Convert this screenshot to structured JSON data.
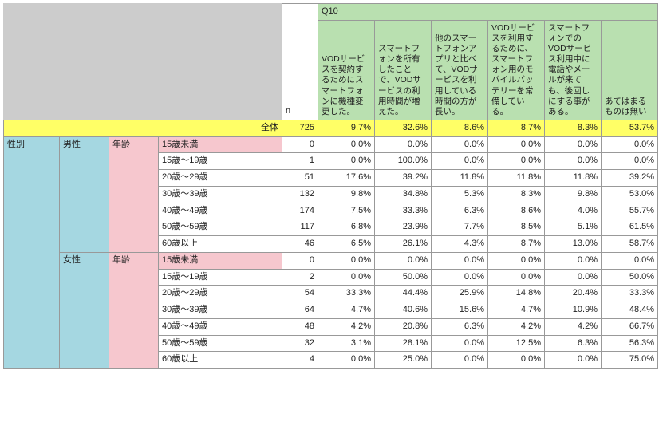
{
  "question": "Q10",
  "n_label": "n",
  "columns": [
    "VODサービスを契約するためにスマートフォンに機種変更した。",
    "スマートフォンを所有したことで、VODサービスの利用時間が増えた。",
    "他のスマートフォンアプリと比べて、VODサービスを利用している時間の方が長い。",
    "VODサービスを利用するために、スマートフォン用のモバイルバッテリーを常備している。",
    "スマートフォンでのVODサービス利用中に電話やメールが来ても、後回しにする事がある。",
    "あてはまるものは無い"
  ],
  "total_label": "全体",
  "total": {
    "n": "725",
    "v": [
      "9.7%",
      "32.6%",
      "8.6%",
      "8.7%",
      "8.3%",
      "53.7%"
    ]
  },
  "dim1": "性別",
  "dim2": "年齢",
  "genders": [
    "男性",
    "女性"
  ],
  "ages": [
    "15歳未満",
    "15歳～19歳",
    "20歳～29歳",
    "30歳～39歳",
    "40歳～49歳",
    "50歳～59歳",
    "60歳以上"
  ],
  "rows": {
    "male": [
      {
        "n": "0",
        "v": [
          "0.0%",
          "0.0%",
          "0.0%",
          "0.0%",
          "0.0%",
          "0.0%"
        ]
      },
      {
        "n": "1",
        "v": [
          "0.0%",
          "100.0%",
          "0.0%",
          "0.0%",
          "0.0%",
          "0.0%"
        ]
      },
      {
        "n": "51",
        "v": [
          "17.6%",
          "39.2%",
          "11.8%",
          "11.8%",
          "11.8%",
          "39.2%"
        ]
      },
      {
        "n": "132",
        "v": [
          "9.8%",
          "34.8%",
          "5.3%",
          "8.3%",
          "9.8%",
          "53.0%"
        ]
      },
      {
        "n": "174",
        "v": [
          "7.5%",
          "33.3%",
          "6.3%",
          "8.6%",
          "4.0%",
          "55.7%"
        ]
      },
      {
        "n": "117",
        "v": [
          "6.8%",
          "23.9%",
          "7.7%",
          "8.5%",
          "5.1%",
          "61.5%"
        ]
      },
      {
        "n": "46",
        "v": [
          "6.5%",
          "26.1%",
          "4.3%",
          "8.7%",
          "13.0%",
          "58.7%"
        ]
      }
    ],
    "female": [
      {
        "n": "0",
        "v": [
          "0.0%",
          "0.0%",
          "0.0%",
          "0.0%",
          "0.0%",
          "0.0%"
        ]
      },
      {
        "n": "2",
        "v": [
          "0.0%",
          "50.0%",
          "0.0%",
          "0.0%",
          "0.0%",
          "50.0%"
        ]
      },
      {
        "n": "54",
        "v": [
          "33.3%",
          "44.4%",
          "25.9%",
          "14.8%",
          "20.4%",
          "33.3%"
        ]
      },
      {
        "n": "64",
        "v": [
          "4.7%",
          "40.6%",
          "15.6%",
          "4.7%",
          "10.9%",
          "48.4%"
        ]
      },
      {
        "n": "48",
        "v": [
          "4.2%",
          "20.8%",
          "6.3%",
          "4.2%",
          "4.2%",
          "66.7%"
        ]
      },
      {
        "n": "32",
        "v": [
          "3.1%",
          "28.1%",
          "0.0%",
          "12.5%",
          "6.3%",
          "56.3%"
        ]
      },
      {
        "n": "4",
        "v": [
          "0.0%",
          "25.0%",
          "0.0%",
          "0.0%",
          "0.0%",
          "75.0%"
        ]
      }
    ]
  },
  "chart_data": {
    "type": "table",
    "title": "Q10",
    "row_dim": [
      "性別",
      "年齢"
    ],
    "columns_n": "n",
    "columns": [
      "VODサービスを契約するためにスマートフォンに機種変更した。",
      "スマートフォンを所有したことで、VODサービスの利用時間が増えた。",
      "他のスマートフォンアプリと比べて、VODサービスを利用している時間の方が長い。",
      "VODサービスを利用するために、スマートフォン用のモバイルバッテリーを常備している。",
      "スマートフォンでのVODサービス利用中に電話やメールが来ても、後回しにする事がある。",
      "あてはまるものは無い"
    ],
    "total": {
      "n": 725,
      "pct": [
        9.7,
        32.6,
        8.6,
        8.7,
        8.3,
        53.7
      ]
    },
    "groups": [
      {
        "gender": "男性",
        "age": "15歳未満",
        "n": 0,
        "pct": [
          0,
          0,
          0,
          0,
          0,
          0
        ]
      },
      {
        "gender": "男性",
        "age": "15歳～19歳",
        "n": 1,
        "pct": [
          0,
          100,
          0,
          0,
          0,
          0
        ]
      },
      {
        "gender": "男性",
        "age": "20歳～29歳",
        "n": 51,
        "pct": [
          17.6,
          39.2,
          11.8,
          11.8,
          11.8,
          39.2
        ]
      },
      {
        "gender": "男性",
        "age": "30歳～39歳",
        "n": 132,
        "pct": [
          9.8,
          34.8,
          5.3,
          8.3,
          9.8,
          53.0
        ]
      },
      {
        "gender": "男性",
        "age": "40歳～49歳",
        "n": 174,
        "pct": [
          7.5,
          33.3,
          6.3,
          8.6,
          4.0,
          55.7
        ]
      },
      {
        "gender": "男性",
        "age": "50歳～59歳",
        "n": 117,
        "pct": [
          6.8,
          23.9,
          7.7,
          8.5,
          5.1,
          61.5
        ]
      },
      {
        "gender": "男性",
        "age": "60歳以上",
        "n": 46,
        "pct": [
          6.5,
          26.1,
          4.3,
          8.7,
          13.0,
          58.7
        ]
      },
      {
        "gender": "女性",
        "age": "15歳未満",
        "n": 0,
        "pct": [
          0,
          0,
          0,
          0,
          0,
          0
        ]
      },
      {
        "gender": "女性",
        "age": "15歳～19歳",
        "n": 2,
        "pct": [
          0,
          50,
          0,
          0,
          0,
          50
        ]
      },
      {
        "gender": "女性",
        "age": "20歳～29歳",
        "n": 54,
        "pct": [
          33.3,
          44.4,
          25.9,
          14.8,
          20.4,
          33.3
        ]
      },
      {
        "gender": "女性",
        "age": "30歳～39歳",
        "n": 64,
        "pct": [
          4.7,
          40.6,
          15.6,
          4.7,
          10.9,
          48.4
        ]
      },
      {
        "gender": "女性",
        "age": "40歳～49歳",
        "n": 48,
        "pct": [
          4.2,
          20.8,
          6.3,
          4.2,
          4.2,
          66.7
        ]
      },
      {
        "gender": "女性",
        "age": "50歳～59歳",
        "n": 32,
        "pct": [
          3.1,
          28.1,
          0,
          12.5,
          6.3,
          56.3
        ]
      },
      {
        "gender": "女性",
        "age": "60歳以上",
        "n": 4,
        "pct": [
          0,
          25,
          0,
          0,
          0,
          75
        ]
      }
    ]
  }
}
